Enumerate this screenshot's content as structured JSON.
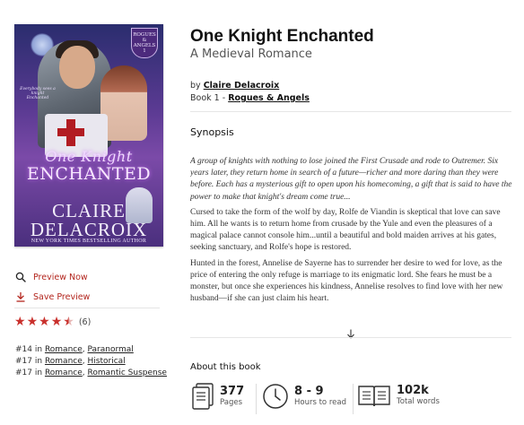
{
  "cover": {
    "series_badge": "ROGUES & ANGELS 1",
    "tagline": "Everybody sees a knight Enchanted",
    "title_line1": "One Knight",
    "title_line2": "ENCHANTED",
    "author_line1": "CLAIRE",
    "author_line2": "DELACROIX",
    "nyt": "NEW YORK TIMES BESTSELLING AUTHOR"
  },
  "actions": {
    "preview_label": "Preview Now",
    "save_label": "Save Preview"
  },
  "rating": {
    "stars": 4.5,
    "count_label": "(6)"
  },
  "ranks": [
    {
      "prefix": "#14 in",
      "category": "Romance",
      "subcategory": "Paranormal"
    },
    {
      "prefix": "#17 in",
      "category": "Romance",
      "subcategory": "Historical"
    },
    {
      "prefix": "#17 in",
      "category": "Romance",
      "subcategory": "Romantic Suspense"
    }
  ],
  "book": {
    "title": "One Knight Enchanted",
    "subtitle": "A Medieval Romance",
    "by_prefix": "by",
    "author": "Claire Delacroix",
    "series_prefix": "Book 1 -",
    "series": "Rogues & Angels"
  },
  "synopsis": {
    "heading": "Synopsis",
    "paragraphs": [
      "A group of knights with nothing to lose joined the First Crusade and rode to Outremer. Six years later, they return home in search of a future—richer and more daring than they were before. Each has a mysterious gift to open upon his homecoming, a gift that is said to have the power to make that knight's dream come true...",
      "Cursed to take the form of the wolf by day, Rolfe de Viandin is skeptical that love can save him. All he wants is to return home from crusade by the Yule and even the pleasures of a magical palace cannot console him...until a beautiful and bold maiden arrives at his gates, seeking sanctuary, and Rolfe's hope is restored.",
      "Hunted in the forest, Annelise de Sayerne has to surrender her desire to wed for love, as the price of entering the only refuge is marriage to its enigmatic lord. She fears he must be a monster, but once she experiences his kindness, Annelise resolves to find love with her new husband—if she can just claim his heart."
    ]
  },
  "about": {
    "heading": "About this book",
    "stats": [
      {
        "value": "377",
        "unit": "Pages"
      },
      {
        "value": "8 - 9",
        "unit": "Hours to read"
      },
      {
        "value": "102k",
        "unit": "Total words"
      }
    ]
  },
  "colors": {
    "accent": "#b3261e",
    "star": "#c9302c"
  }
}
